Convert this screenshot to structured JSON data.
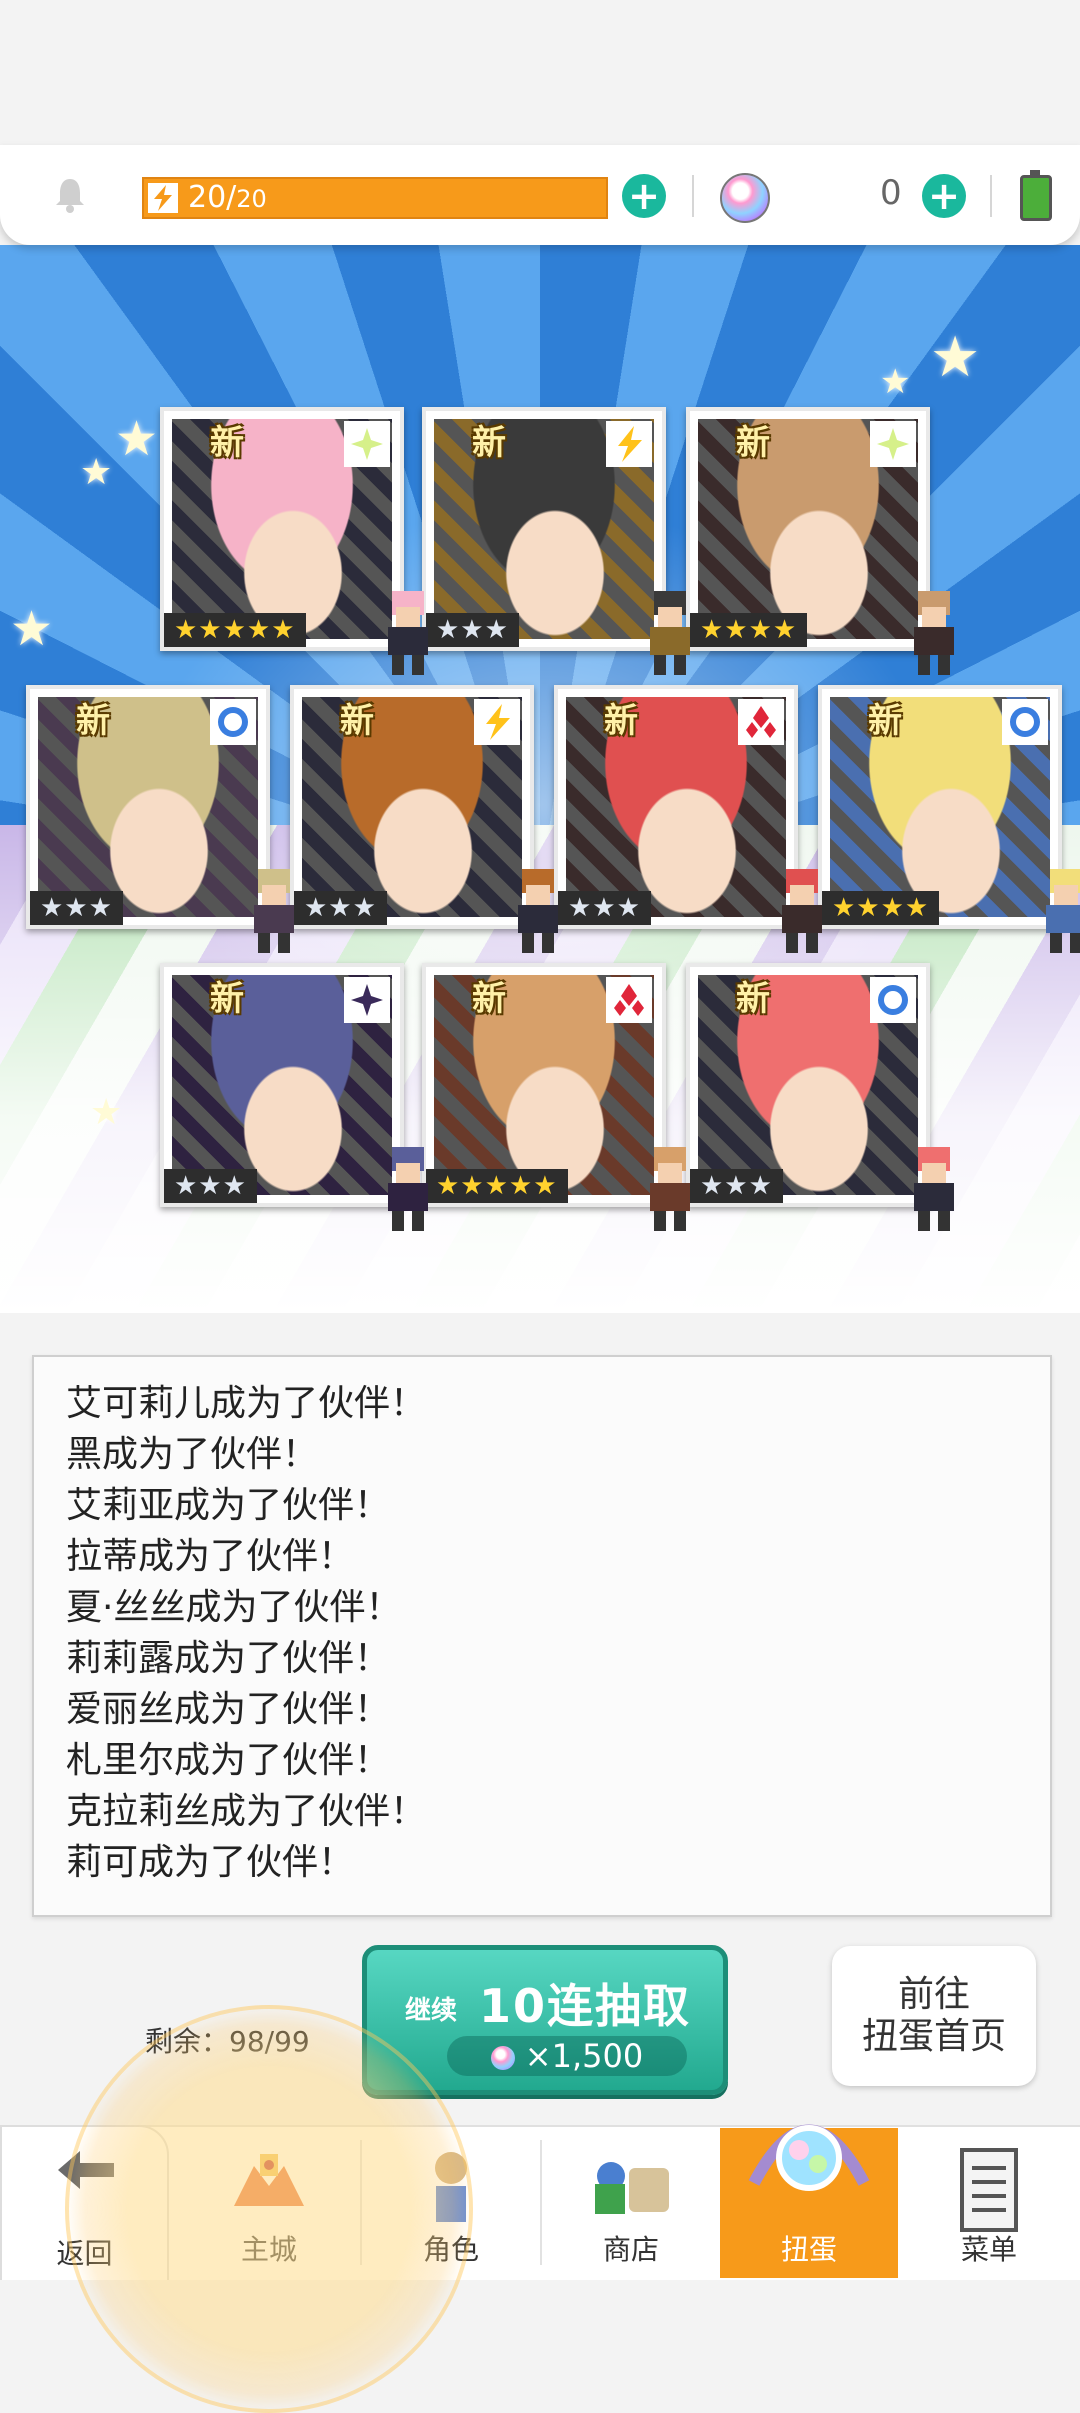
{
  "topbar": {
    "stamina_current": "20/",
    "stamina_max": "20",
    "stamina_fraction": 1.0,
    "gem_count": "0",
    "icons": [
      "bell-icon",
      "lightning-icon",
      "plus-icon",
      "gem-icon",
      "plus-icon",
      "battery-icon"
    ]
  },
  "summon_results": {
    "new_label": "新",
    "cards": [
      {
        "element": "light",
        "stars": "★★★★★",
        "rarity": 5
      },
      {
        "element": "thunder",
        "stars": "★★★",
        "rarity": 3
      },
      {
        "element": "light",
        "stars": "★★★★",
        "rarity": 4
      },
      {
        "element": "water",
        "stars": "★★★",
        "rarity": 3
      },
      {
        "element": "thunder",
        "stars": "★★★",
        "rarity": 3
      },
      {
        "element": "fire",
        "stars": "★★★",
        "rarity": 3
      },
      {
        "element": "water",
        "stars": "★★★★",
        "rarity": 4
      },
      {
        "element": "dark",
        "stars": "★★★",
        "rarity": 3
      },
      {
        "element": "fire",
        "stars": "★★★★★",
        "rarity": 5
      },
      {
        "element": "water",
        "stars": "★★★",
        "rarity": 3
      }
    ]
  },
  "log": {
    "lines": [
      "艾可莉儿成为了伙伴！",
      "黑成为了伙伴！",
      "艾莉亚成为了伙伴！",
      "拉蒂成为了伙伴！",
      "夏·丝丝成为了伙伴！",
      "莉莉露成为了伙伴！",
      "爱丽丝成为了伙伴！",
      "札里尔成为了伙伴！",
      "克拉莉丝成为了伙伴！",
      "莉可成为了伙伴！"
    ]
  },
  "actions": {
    "remaining": "剩余：98/99",
    "continue_label": "继续",
    "summon_label": "10连抽取",
    "summon_cost": "×1,500",
    "goto_line1": "前往",
    "goto_line2": "扭蛋首页"
  },
  "nav": {
    "back": "返回",
    "items": [
      "主城",
      "角色",
      "商店",
      "扭蛋",
      "菜单"
    ],
    "active": "扭蛋"
  },
  "colors": {
    "accent_orange": "#f79a1a",
    "teal": "#1ab89d",
    "star_gold": "#ffd22e"
  }
}
